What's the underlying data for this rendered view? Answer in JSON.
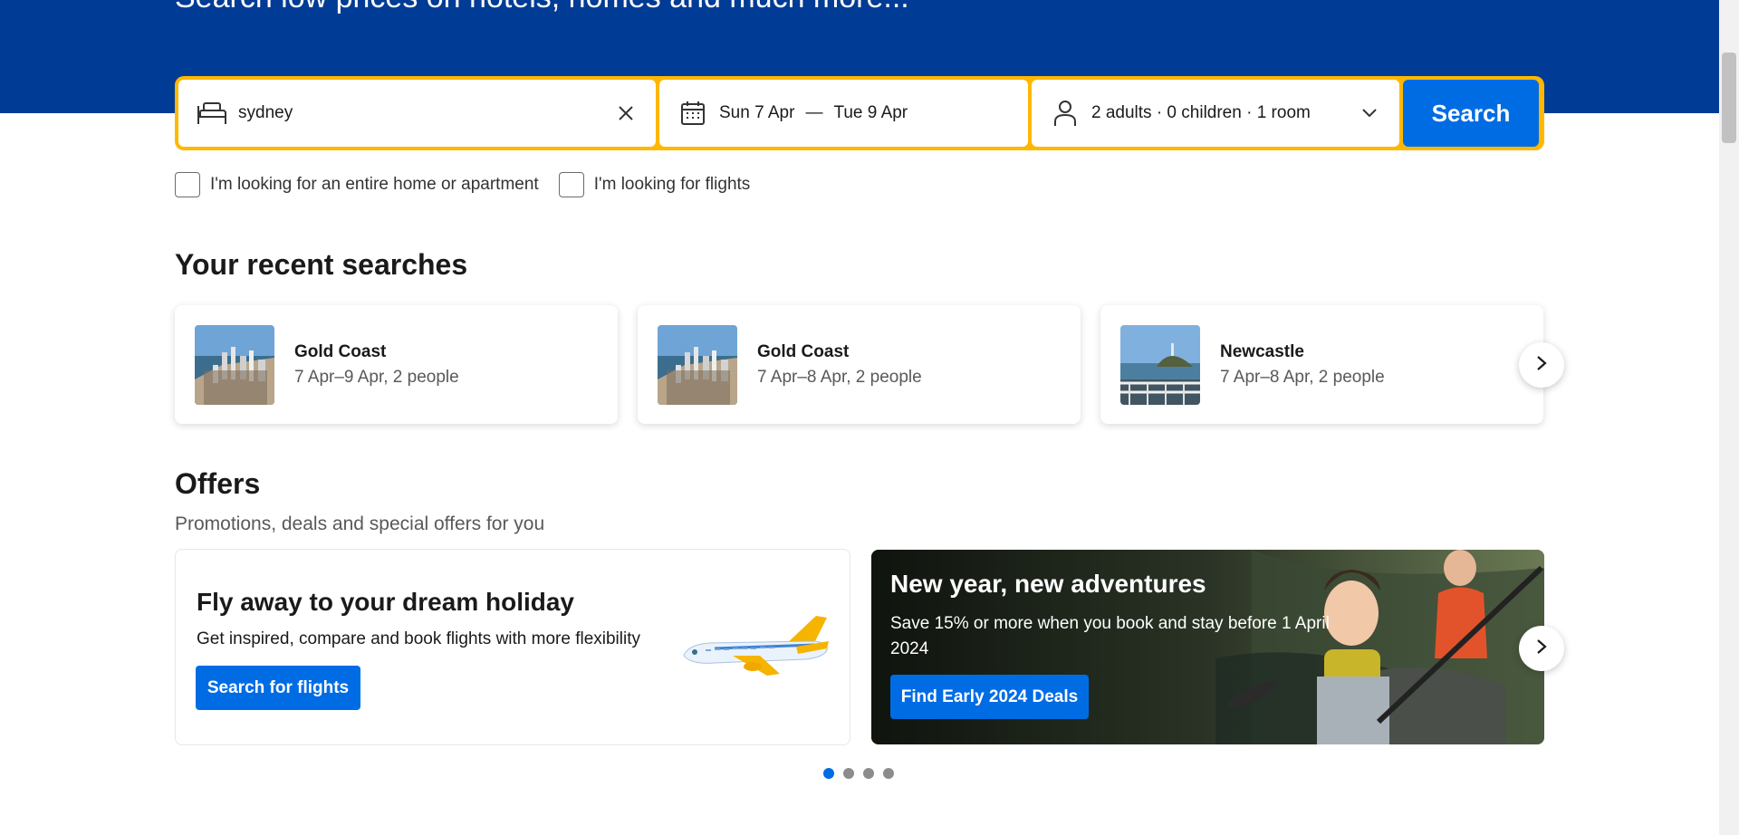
{
  "hero": {
    "title": "Search low prices on hotels, homes and much more..."
  },
  "search": {
    "destination_value": "sydney",
    "check_in": "Sun 7 Apr",
    "separator": "—",
    "check_out": "Tue 9 Apr",
    "guests": "2 adults · 0 children · 1 room",
    "button": "Search",
    "icons": [
      "bed-icon",
      "clear-icon",
      "calendar-icon",
      "person-icon",
      "chevron-down-icon"
    ]
  },
  "checkboxes": [
    {
      "label": "I'm looking for an entire home or apartment",
      "checked": false
    },
    {
      "label": "I'm looking for flights",
      "checked": false
    }
  ],
  "recent": {
    "heading": "Your recent searches",
    "items": [
      {
        "title": "Gold Coast",
        "meta": "7 Apr–9 Apr, 2 people"
      },
      {
        "title": "Gold Coast",
        "meta": "7 Apr–8 Apr, 2 people"
      },
      {
        "title": "Newcastle",
        "meta": "7 Apr–8 Apr, 2 people"
      }
    ]
  },
  "offers": {
    "heading": "Offers",
    "subtitle": "Promotions, deals and special offers for you",
    "card1": {
      "title": "Fly away to your dream holiday",
      "desc": "Get inspired, compare and book flights with more flexibility",
      "button": "Search for flights"
    },
    "card2": {
      "title": "New year, new adventures",
      "desc": "Save 15% or more when you book and stay before 1 April 2024",
      "button": "Find Early 2024 Deals"
    },
    "pagination": {
      "pages": 4,
      "active": 1
    }
  },
  "colors": {
    "brand_blue": "#003b95",
    "action_blue": "#006ce4",
    "search_border": "#ffb700"
  }
}
